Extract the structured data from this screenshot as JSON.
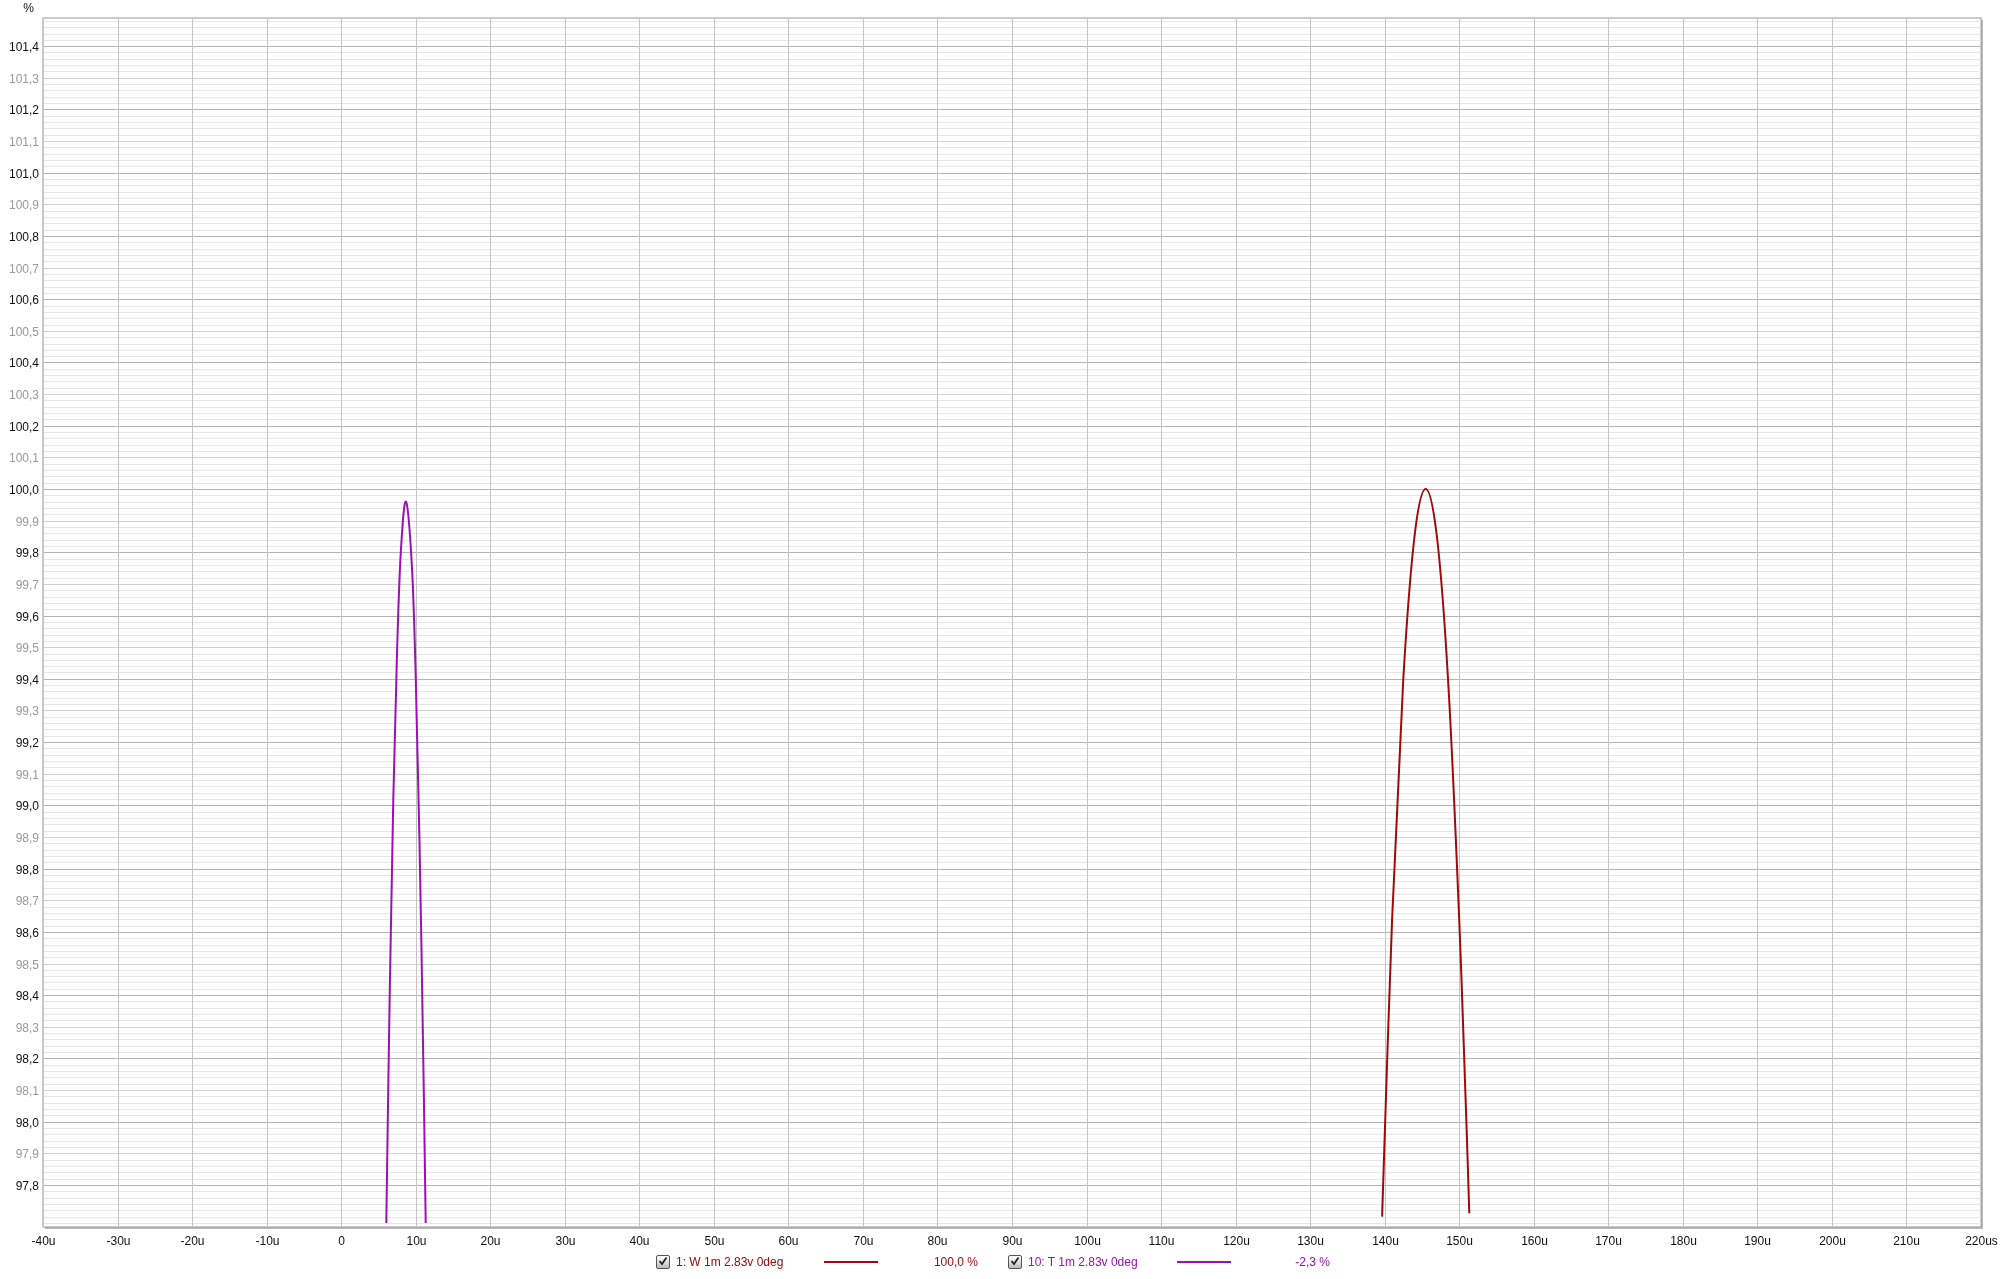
{
  "chart_data": {
    "type": "line",
    "ylabel": "%",
    "grid": true,
    "x": [
      6.06,
      6.5,
      7,
      7.5,
      8,
      8.7,
      9.5,
      10,
      10.5,
      11,
      11.34,
      139.65,
      141,
      142.5,
      144,
      145.5,
      147,
      148.5,
      150,
      151,
      151.35
    ],
    "series": [
      {
        "name": "1: W 1m 2.83v 0deg",
        "color": "#a00a0a",
        "values": [
          null,
          null,
          null,
          null,
          null,
          null,
          null,
          null,
          null,
          null,
          null,
          97.7,
          98.64,
          99.4,
          99.85,
          100.0,
          99.85,
          99.4,
          98.64,
          97.97,
          97.71
        ]
      },
      {
        "name": "10: T 1m 2.83v 0deg",
        "color": "#9c10b4",
        "values": [
          97.68,
          98.38,
          99.02,
          99.49,
          99.8,
          99.96,
          99.75,
          99.41,
          98.9,
          98.23,
          97.68,
          null,
          null,
          null,
          null,
          null,
          null,
          null,
          null,
          null,
          null
        ]
      }
    ],
    "xlim": [
      -40,
      220
    ],
    "ylim": [
      97.667,
      101.489
    ],
    "xticks": [
      {
        "value": -40,
        "label": "-40u"
      },
      {
        "value": -30,
        "label": "-30u"
      },
      {
        "value": -20,
        "label": "-20u"
      },
      {
        "value": -10,
        "label": "-10u"
      },
      {
        "value": 0,
        "label": "0"
      },
      {
        "value": 10,
        "label": "10u"
      },
      {
        "value": 20,
        "label": "20u"
      },
      {
        "value": 30,
        "label": "30u"
      },
      {
        "value": 40,
        "label": "40u"
      },
      {
        "value": 50,
        "label": "50u"
      },
      {
        "value": 60,
        "label": "60u"
      },
      {
        "value": 70,
        "label": "70u"
      },
      {
        "value": 80,
        "label": "80u"
      },
      {
        "value": 90,
        "label": "90u"
      },
      {
        "value": 100,
        "label": "100u"
      },
      {
        "value": 110,
        "label": "110u"
      },
      {
        "value": 120,
        "label": "120u"
      },
      {
        "value": 130,
        "label": "130u"
      },
      {
        "value": 140,
        "label": "140u"
      },
      {
        "value": 150,
        "label": "150u"
      },
      {
        "value": 160,
        "label": "160u"
      },
      {
        "value": 170,
        "label": "170u"
      },
      {
        "value": 180,
        "label": "180u"
      },
      {
        "value": 190,
        "label": "190u"
      },
      {
        "value": 200,
        "label": "200u"
      },
      {
        "value": 210,
        "label": "210u"
      },
      {
        "value": 220,
        "label": "220us"
      }
    ],
    "yticks": [
      {
        "value": 97.8,
        "label": "97,8"
      },
      {
        "value": 97.9,
        "label": "97,9"
      },
      {
        "value": 98.0,
        "label": "98,0"
      },
      {
        "value": 98.1,
        "label": "98,1"
      },
      {
        "value": 98.2,
        "label": "98,2"
      },
      {
        "value": 98.3,
        "label": "98,3"
      },
      {
        "value": 98.4,
        "label": "98,4"
      },
      {
        "value": 98.5,
        "label": "98,5"
      },
      {
        "value": 98.6,
        "label": "98,6"
      },
      {
        "value": 98.7,
        "label": "98,7"
      },
      {
        "value": 98.8,
        "label": "98,8"
      },
      {
        "value": 98.9,
        "label": "98,9"
      },
      {
        "value": 99.0,
        "label": "99,0"
      },
      {
        "value": 99.1,
        "label": "99,1"
      },
      {
        "value": 99.2,
        "label": "99,2"
      },
      {
        "value": 99.3,
        "label": "99,3"
      },
      {
        "value": 99.4,
        "label": "99,4"
      },
      {
        "value": 99.5,
        "label": "99,5"
      },
      {
        "value": 99.6,
        "label": "99,6"
      },
      {
        "value": 99.7,
        "label": "99,7"
      },
      {
        "value": 99.8,
        "label": "99,8"
      },
      {
        "value": 99.9,
        "label": "99,9"
      },
      {
        "value": 100.0,
        "label": "100,0"
      },
      {
        "value": 100.1,
        "label": "100,1"
      },
      {
        "value": 100.2,
        "label": "100,2"
      },
      {
        "value": 100.3,
        "label": "100,3"
      },
      {
        "value": 100.4,
        "label": "100,4"
      },
      {
        "value": 100.5,
        "label": "100,5"
      },
      {
        "value": 100.6,
        "label": "100,6"
      },
      {
        "value": 100.7,
        "label": "100,7"
      },
      {
        "value": 100.8,
        "label": "100,8"
      },
      {
        "value": 100.9,
        "label": "100,9"
      },
      {
        "value": 101.0,
        "label": "101,0"
      },
      {
        "value": 101.1,
        "label": "101,1"
      },
      {
        "value": 101.2,
        "label": "101,2"
      },
      {
        "value": 101.3,
        "label": "101,3"
      },
      {
        "value": 101.4,
        "label": "101,4"
      }
    ]
  },
  "legend": [
    {
      "checked": true,
      "value": "100,0 %"
    },
    {
      "checked": true,
      "value": "-2,3 %"
    }
  ]
}
